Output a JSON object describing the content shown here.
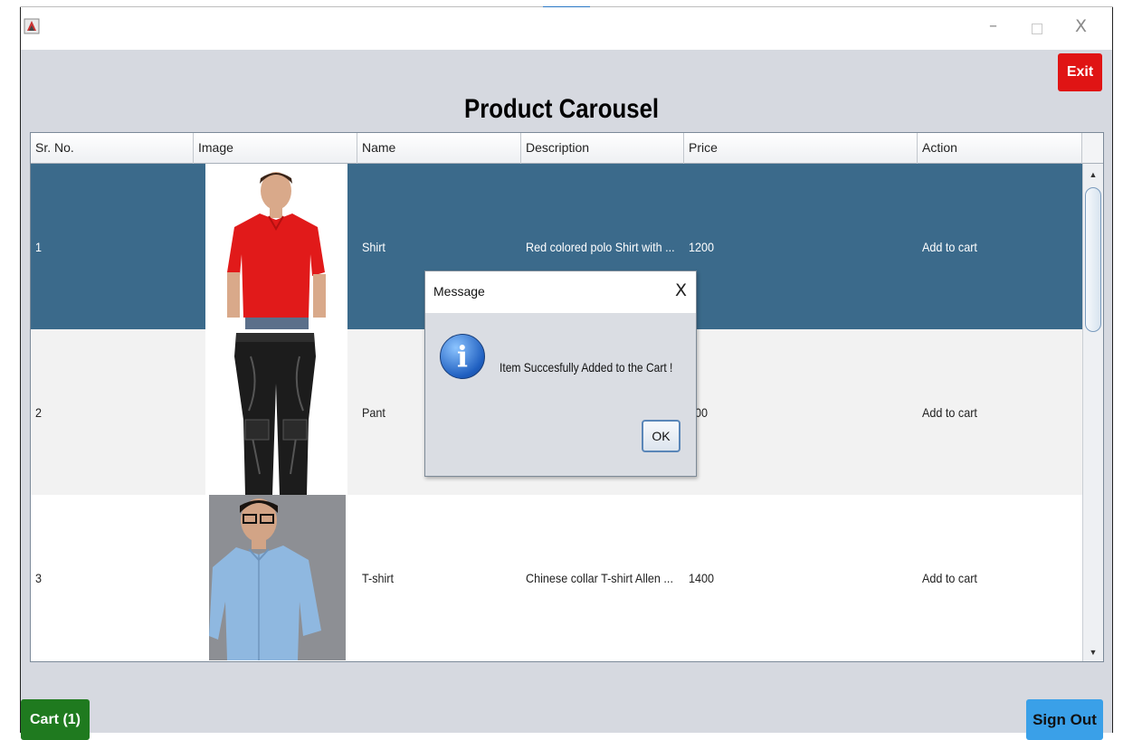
{
  "window": {
    "title": ""
  },
  "header": {
    "exit_label": "Exit",
    "title": "Product Carousel"
  },
  "table": {
    "columns": [
      "Sr. No.",
      "Image",
      "Name",
      "Description",
      "Price",
      "Action"
    ],
    "rows": [
      {
        "sr": "1",
        "name": "Shirt",
        "description": "Red colored polo Shirt with ...",
        "price": "1200",
        "action": "Add to cart"
      },
      {
        "sr": "2",
        "name": "Pant",
        "description": "",
        "price": "300",
        "action": "Add to cart"
      },
      {
        "sr": "3",
        "name": "T-shirt",
        "description": "Chinese collar T-shirt Allen ...",
        "price": "1400",
        "action": "Add to cart"
      }
    ]
  },
  "footer": {
    "cart_label": "Cart (1)",
    "signout_label": "Sign Out"
  },
  "dialog": {
    "title": "Message",
    "message": "Item Succesfully Added to the Cart !",
    "ok_label": "OK"
  },
  "colors": {
    "selected_row": "#3b6a8b",
    "exit": "#e01414",
    "cart": "#1f7a1f",
    "signout": "#3aa0e8"
  }
}
